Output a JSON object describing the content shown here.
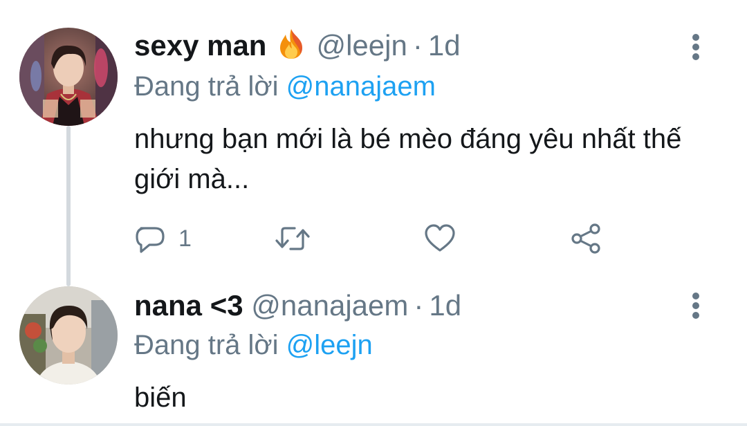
{
  "tweets": [
    {
      "display_name": "sexy man",
      "name_emoji": "fire-icon",
      "handle": "@leejn",
      "separator": "·",
      "time": "1d",
      "reply_prefix": "Đang trả lời",
      "reply_mention": "@nanajaem",
      "text": "nhưng bạn mới là bé mèo đáng yêu nhất thế giới mà...",
      "reply_count": "1",
      "has_actions": true
    },
    {
      "display_name": "nana <3",
      "handle": "@nanajaem",
      "separator": "·",
      "time": "1d",
      "reply_prefix": "Đang trả lời",
      "reply_mention": "@leejn",
      "text": "biến",
      "has_actions": false
    }
  ],
  "colors": {
    "text_primary": "#14171a",
    "text_secondary": "#657786",
    "accent": "#1da1f2",
    "thread_line": "#d3d9de"
  }
}
